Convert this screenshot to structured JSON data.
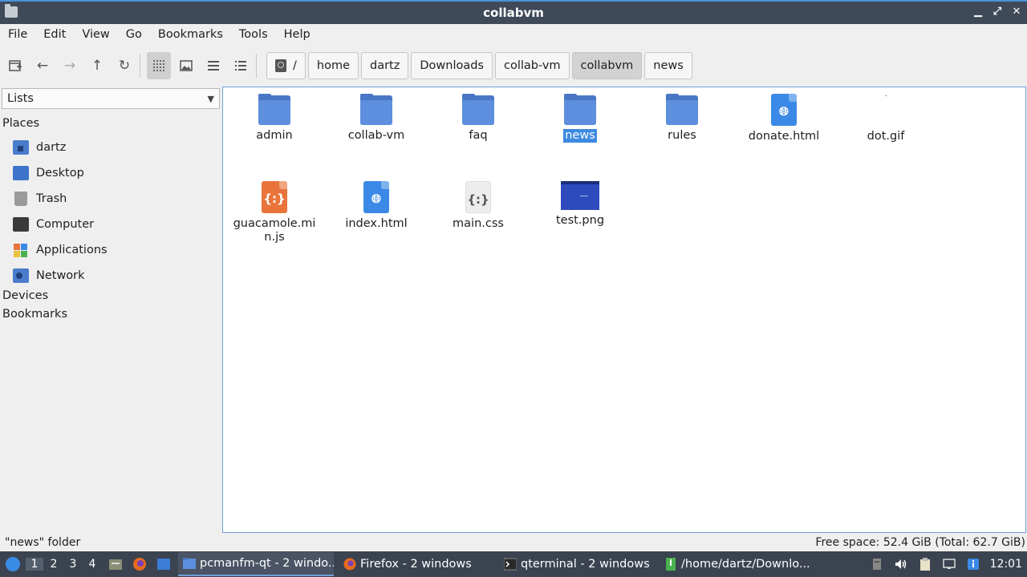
{
  "window": {
    "title": "collabvm"
  },
  "menubar": [
    "File",
    "Edit",
    "View",
    "Go",
    "Bookmarks",
    "Tools",
    "Help"
  ],
  "breadcrumbs": {
    "root": "/",
    "parts": [
      "home",
      "dartz",
      "Downloads",
      "collab-vm",
      "collabvm",
      "news"
    ],
    "active": "collabvm"
  },
  "sidebar": {
    "view_selector": "Lists",
    "places_header": "Places",
    "places": [
      {
        "label": "dartz",
        "icon": "home-folder-icon"
      },
      {
        "label": "Desktop",
        "icon": "desktop-icon"
      },
      {
        "label": "Trash",
        "icon": "trash-icon"
      },
      {
        "label": "Computer",
        "icon": "computer-icon"
      },
      {
        "label": "Applications",
        "icon": "applications-icon"
      },
      {
        "label": "Network",
        "icon": "network-icon"
      }
    ],
    "devices_header": "Devices",
    "bookmarks_header": "Bookmarks"
  },
  "files": [
    {
      "name": "admin",
      "type": "folder"
    },
    {
      "name": "collab-vm",
      "type": "folder"
    },
    {
      "name": "faq",
      "type": "folder"
    },
    {
      "name": "news",
      "type": "folder",
      "selected": true
    },
    {
      "name": "rules",
      "type": "folder"
    },
    {
      "name": "donate.html",
      "type": "html"
    },
    {
      "name": "dot.gif",
      "type": "gif"
    },
    {
      "name": "guacamole.min.js",
      "type": "js"
    },
    {
      "name": "index.html",
      "type": "html"
    },
    {
      "name": "main.css",
      "type": "css"
    },
    {
      "name": "test.png",
      "type": "png"
    }
  ],
  "status": {
    "left": "\"news\" folder",
    "right": "Free space: 52.4 GiB (Total: 62.7 GiB)"
  },
  "taskbar": {
    "desktops": [
      "1",
      "2",
      "3",
      "4"
    ],
    "active_desktop": "1",
    "tasks": [
      {
        "label": "pcmanfm-qt - 2 windo...",
        "icon": "folder-icon",
        "active": true
      },
      {
        "label": "Firefox - 2 windows",
        "icon": "firefox-icon"
      },
      {
        "label": "qterminal - 2 windows",
        "icon": "terminal-icon"
      },
      {
        "label": "/home/dartz/Downlo...",
        "icon": "archive-icon"
      }
    ],
    "clock": "12:01"
  },
  "colors": {
    "accent": "#3d8ae0",
    "titlebar": "#3f4a59",
    "taskbar": "#3b4350",
    "folder": "#5d8fde"
  }
}
